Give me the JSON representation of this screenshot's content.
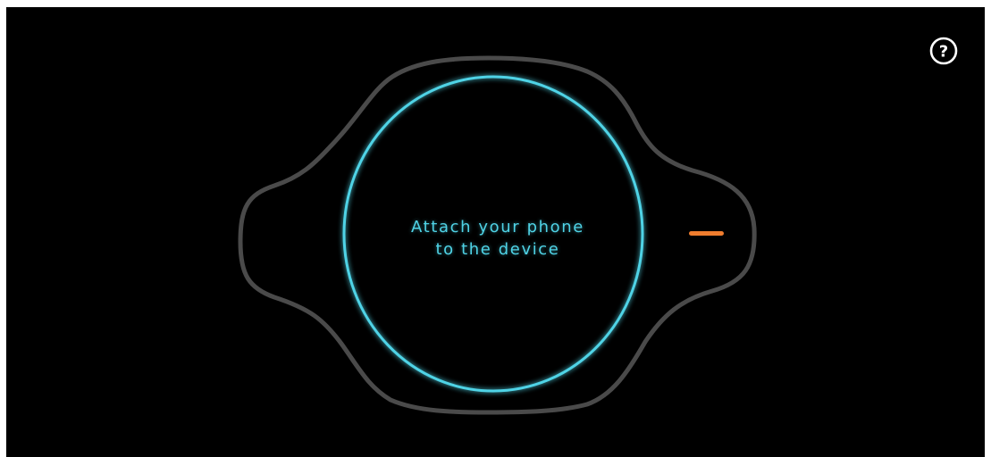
{
  "help": {
    "icon": "question-circle-icon",
    "glyph": "?"
  },
  "prompt": {
    "line1": "Attach your phone",
    "line2": "to the device"
  },
  "colors": {
    "background": "#000000",
    "device_outline": "#4a4a4a",
    "ring": "#4fd3e6",
    "indicator": "#f07d2e",
    "help_icon": "#ffffff"
  }
}
